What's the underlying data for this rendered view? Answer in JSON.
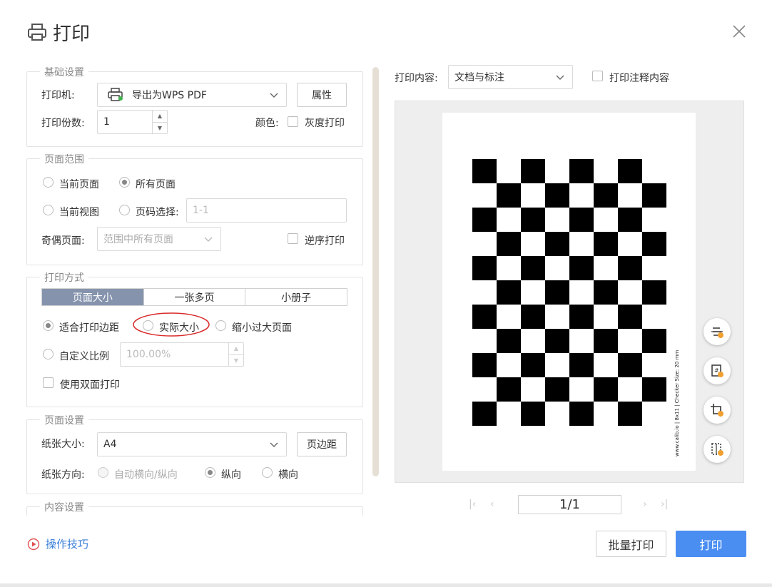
{
  "dialog": {
    "title": "打印",
    "icon": "printer-icon"
  },
  "basic": {
    "legend": "基础设置",
    "printer_label": "打印机:",
    "printer_value": "导出为WPS PDF",
    "properties_button": "属性",
    "copies_label": "打印份数:",
    "copies_value": "1",
    "color_label": "颜色:",
    "grayscale_label": "灰度打印"
  },
  "range": {
    "legend": "页面范围",
    "current_page": "当前页面",
    "all_pages": "所有页面",
    "current_view": "当前视图",
    "page_select": "页码选择:",
    "page_select_placeholder": "1-1",
    "odd_even_label": "奇偶页面:",
    "odd_even_value": "范围中所有页面",
    "reverse_label": "逆序打印"
  },
  "mode": {
    "legend": "打印方式",
    "tabs": [
      "页面大小",
      "一张多页",
      "小册子"
    ],
    "fit_margin": "适合打印边距",
    "actual_size": "实际大小",
    "shrink_large": "缩小过大页面",
    "custom_scale": "自定义比例",
    "scale_value": "100.00%",
    "duplex": "使用双面打印"
  },
  "page_setup": {
    "legend": "页面设置",
    "paper_size_label": "纸张大小:",
    "paper_size_value": "A4",
    "margins_button": "页边距",
    "orientation_label": "纸张方向:",
    "auto": "自动横向/纵向",
    "portrait": "纵向",
    "landscape": "横向"
  },
  "content_setup": {
    "legend": "内容设置"
  },
  "preview": {
    "content_label": "打印内容:",
    "content_value": "文档与标注",
    "print_annotations": "打印注释内容",
    "side_text": "www.calib.io | 8x11 | Checker Size: 20 mm",
    "page_indicator": "1/1",
    "checker_rows": 11,
    "checker_cols": 8
  },
  "footer": {
    "tips": "操作技巧",
    "batch_print": "批量打印",
    "print": "打印"
  },
  "colors": {
    "accent": "#4a8ef2",
    "tab_active": "#8593ad",
    "annotation": "#d92b2b"
  }
}
